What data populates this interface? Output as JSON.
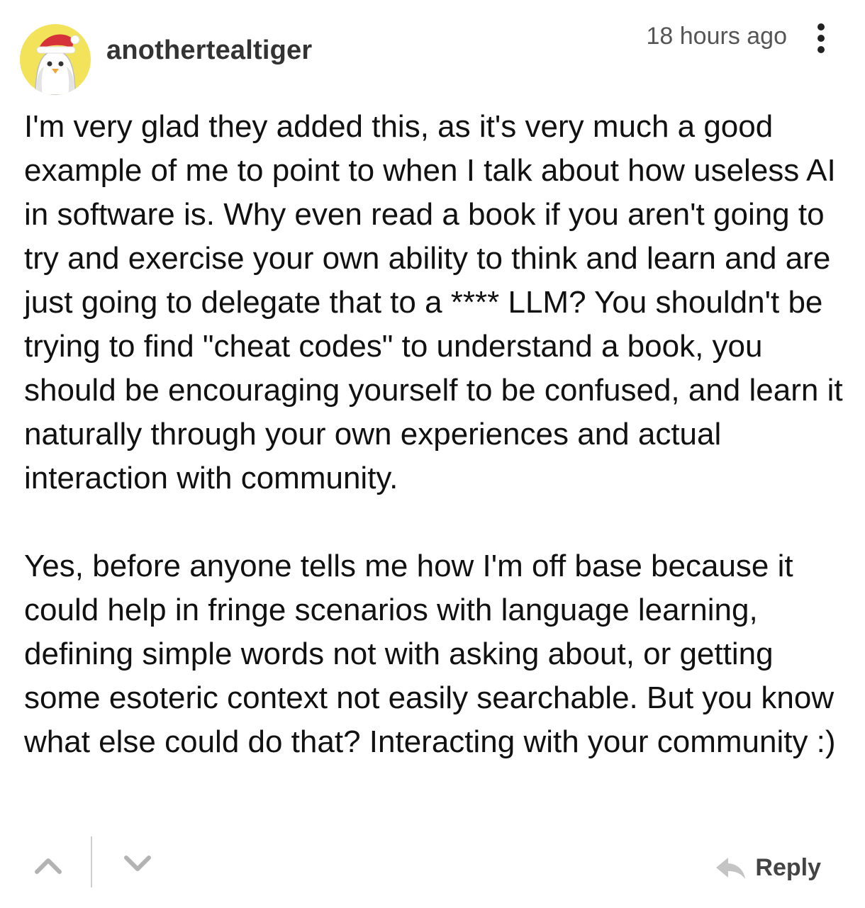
{
  "comment": {
    "author": "anothertealtiger",
    "timestamp": "18 hours ago",
    "avatar_icon": "penguin-santa-hat-avatar",
    "paragraphs": [
      "I'm very glad they added this, as it's very much a good example of me to point to when I talk about how useless AI in software is. Why even read a book if you aren't going to try and exercise your own ability to think and learn and are just going to delegate that to a **** LLM? You shouldn't be trying to find \"cheat codes\" to understand a book, you should be encouraging yourself to be confused, and learn it naturally through your own experiences and actual interaction with community.",
      "Yes, before anyone tells me how I'm off base because it could help in fringe scenarios with language learning, defining simple words not with asking about, or getting some esoteric context not easily searchable. But you know what else could do that? Interacting with your community :)"
    ]
  },
  "actions": {
    "upvote_icon": "chevron-up-icon",
    "downvote_icon": "chevron-down-icon",
    "reply_icon": "reply-arrow-icon",
    "reply_label": "Reply",
    "more_icon": "vertical-ellipsis-icon"
  },
  "colors": {
    "avatar_background": "#f2e35a",
    "hat_red": "#d6323a",
    "text": "#111111",
    "muted": "#555555",
    "icon_gray": "#b3b3b3"
  }
}
